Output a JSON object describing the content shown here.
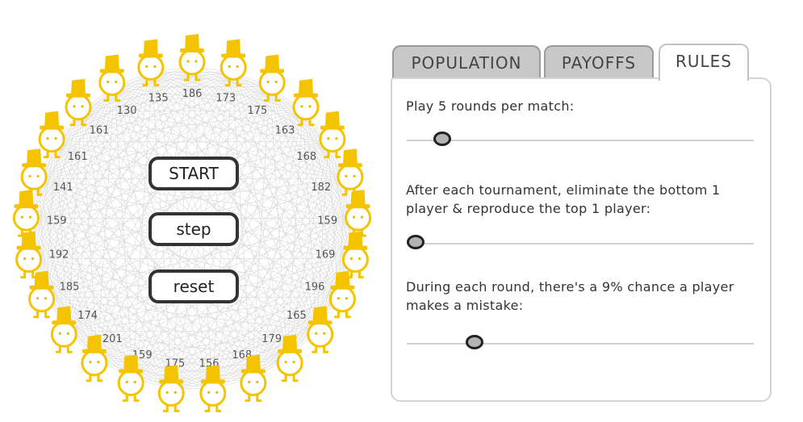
{
  "tournament": {
    "scores": [
      "186",
      "173",
      "175",
      "163",
      "168",
      "182",
      "159",
      "169",
      "196",
      "165",
      "179",
      "168",
      "156",
      "175",
      "159",
      "201",
      "174",
      "185",
      "192",
      "159",
      "141",
      "161",
      "161",
      "130",
      "135"
    ],
    "player_color": "#f5c400",
    "player_outline": "#e8b800",
    "player_type": "always-cooperate",
    "network_color": "#d8d8d8"
  },
  "controls": {
    "start_label": "START",
    "step_label": "step",
    "reset_label": "reset"
  },
  "tabs": {
    "population": "POPULATION",
    "payoffs": "PAYOFFS",
    "rules": "RULES",
    "active": "rules"
  },
  "rules": {
    "rounds_text": "Play 5 rounds per match:",
    "rounds_value": 5,
    "rounds_range": [
      1,
      50
    ],
    "elimination_text": "After each tournament, eliminate the bottom 1 player & reproduce the top 1 player:",
    "elimination_value": 1,
    "elimination_range": [
      1,
      12
    ],
    "mistake_text": "During each round, there's a 9% chance a player makes a mistake:",
    "mistake_value": 9,
    "mistake_range": [
      0,
      50
    ]
  }
}
